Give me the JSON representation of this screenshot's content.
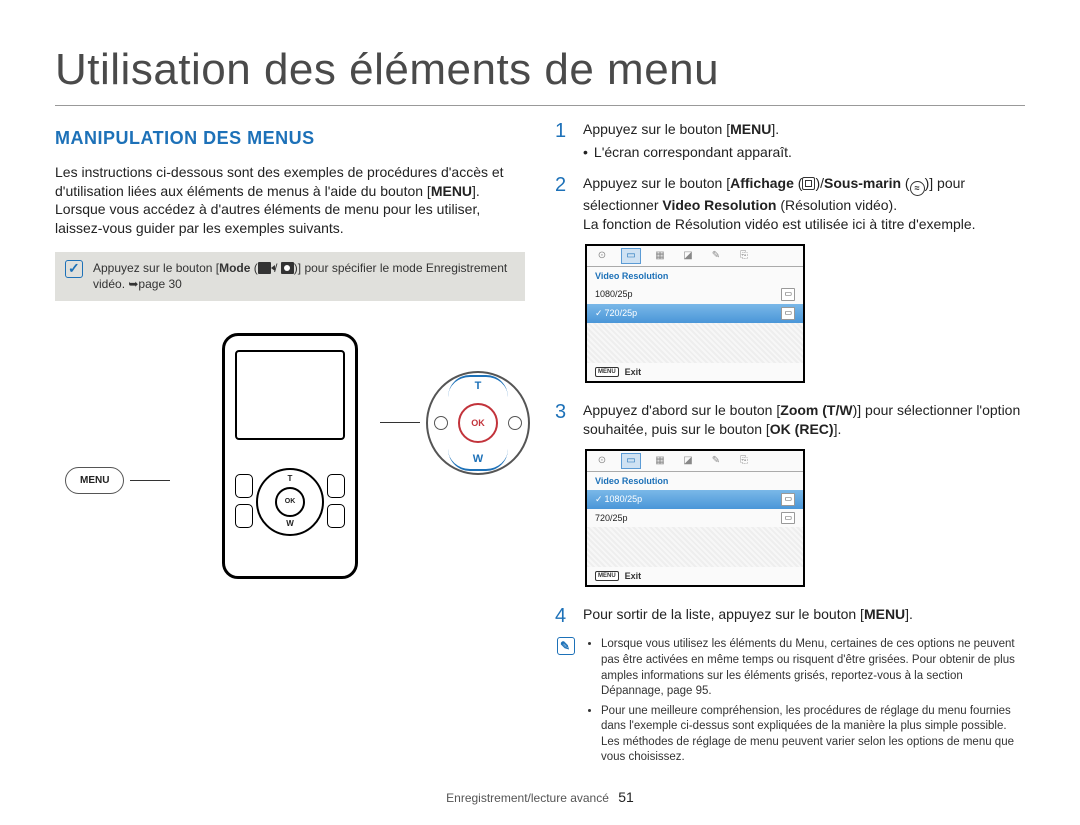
{
  "title": "Utilisation des éléments de menu",
  "section_head": "MANIPULATION DES MENUS",
  "intro": {
    "p1_a": "Les instructions ci-dessous sont des exemples de procédures d'accès et d'utilisation liées aux éléments de menus à l'aide du bouton [",
    "p1_bold": "MENU",
    "p1_b": "]. Lorsque vous accédez à d'autres éléments de menu pour les utiliser, laissez-vous guider par les exemples suivants."
  },
  "mode_note": {
    "a": "Appuyez sur le bouton [",
    "b": "Mode",
    "c": " (",
    "d": ")] pour spécifier le mode Enregistrement vidéo. ",
    "e": "page 30"
  },
  "callouts": {
    "menu_label": "MENU"
  },
  "dpad": {
    "t": "T",
    "w": "W",
    "ok": "OK"
  },
  "steps": {
    "s1": {
      "num": "1",
      "a": "Appuyez sur le bouton [",
      "menu": "MENU",
      "b": "].",
      "sub1": "L'écran correspondant apparaît."
    },
    "s2": {
      "num": "2",
      "a": "Appuyez sur le bouton [",
      "aff": "Affichage",
      "mid": " (",
      "sous": "Sous-marin",
      "mid2": " (",
      "close": ")] pour sélectionner ",
      "vr": "Video Resolution",
      "close2": " (Résolution vidéo).",
      "line2": "La fonction de Résolution vidéo est utilisée ici à titre d'exemple."
    },
    "s3": {
      "num": "3",
      "a": "Appuyez d'abord sur le bouton [",
      "zoom": "Zoom",
      "tw": " (T/W",
      "mid": ")] pour sélectionner l'option souhaitée, puis sur le bouton [",
      "ok": "OK (REC)",
      "close": "]."
    },
    "s4": {
      "num": "4",
      "a": "Pour sortir de la liste, appuyez sur le bouton [",
      "menu": "MENU",
      "b": "]."
    }
  },
  "screens": {
    "menu_title": "Video Resolution",
    "opt1": "1080/25p",
    "opt2": "720/25p",
    "exit_icon": "MENU",
    "exit": "Exit"
  },
  "bottom_note": {
    "li1": "Lorsque vous utilisez les éléments du Menu, certaines de ces options ne peuvent pas être activées en même temps ou risquent d'être grisées. Pour obtenir de plus amples informations sur les éléments grisés, reportez-vous à la section Dépannage, page 95.",
    "li2": "Pour une meilleure compréhension, les procédures de réglage du menu fournies dans l'exemple ci-dessus sont expliquées de la manière la plus simple possible. Les méthodes de réglage de menu peuvent varier selon les options de menu que vous choisissez."
  },
  "footer": {
    "section": "Enregistrement/lecture avancé",
    "page": "51"
  }
}
